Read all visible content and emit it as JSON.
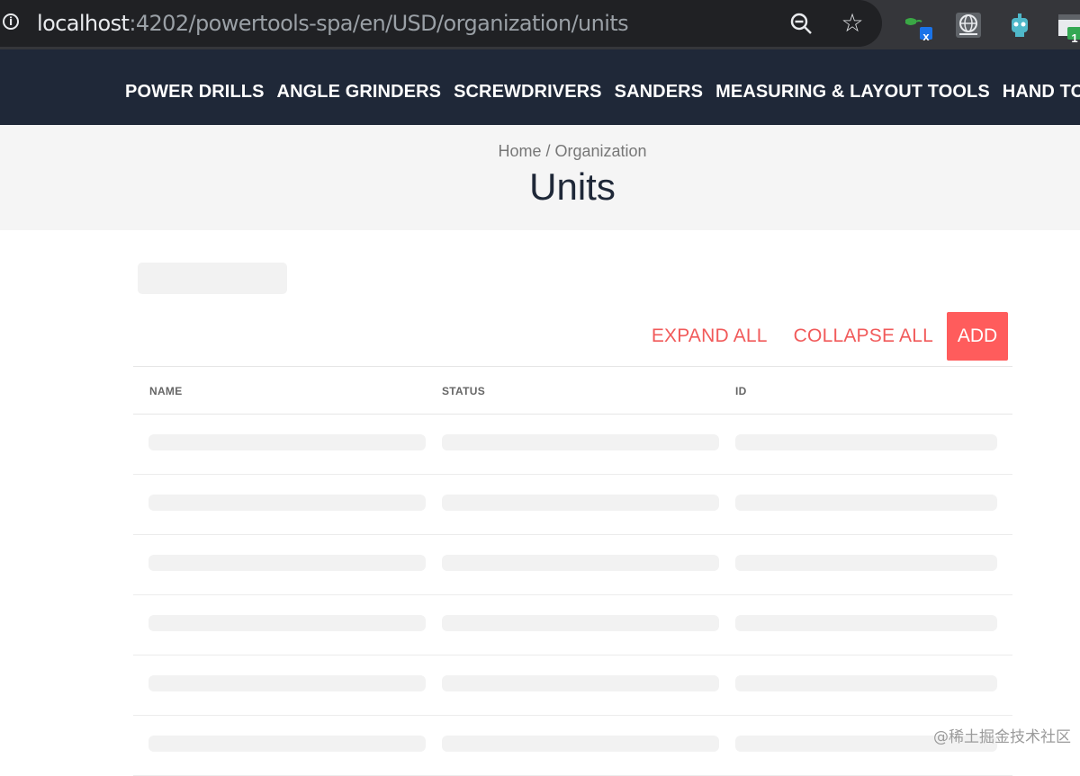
{
  "browser": {
    "url_host": "localhost",
    "url_path": ":4202/powertools-spa/en/USD/organization/units",
    "extension_badges": [
      "x",
      "1"
    ]
  },
  "nav": {
    "items": [
      "POWER DRILLS",
      "ANGLE GRINDERS",
      "SCREWDRIVERS",
      "SANDERS",
      "MEASURING & LAYOUT TOOLS",
      "HAND TOOLS"
    ]
  },
  "breadcrumb": {
    "home": "Home",
    "separator": " / ",
    "current": "Organization"
  },
  "page": {
    "title": "Units"
  },
  "actions": {
    "expand_all": "EXPAND ALL",
    "collapse_all": "COLLAPSE ALL",
    "add": "ADD"
  },
  "table": {
    "columns": [
      "NAME",
      "STATUS",
      "ID"
    ],
    "loading_rows": 6
  },
  "watermark": "@稀土掘金技术社区",
  "colors": {
    "nav_background": "#1f2838",
    "accent": "#ff5c5c",
    "link": "#f15a5a"
  }
}
